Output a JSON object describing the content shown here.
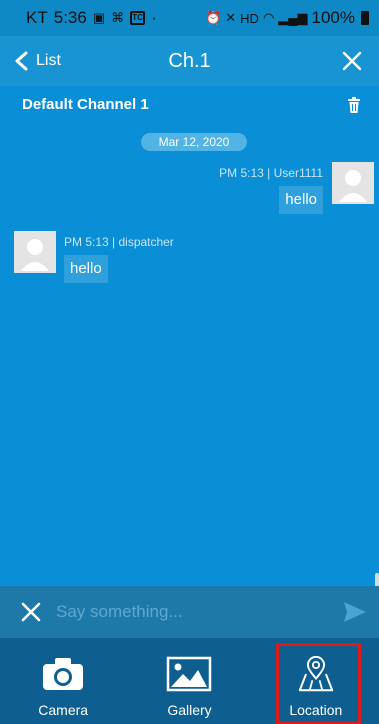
{
  "status_bar": {
    "carrier": "KT",
    "time": "5:36",
    "battery": "100%",
    "icons": [
      "image-icon",
      "lens-icon",
      "tc-app-icon",
      "alarm-icon",
      "mute-icon",
      "hd-icon",
      "wifi-icon",
      "signal-icon",
      "battery-icon"
    ],
    "tc_label": "TC",
    "hd_label": "HD",
    "dot": "·"
  },
  "header": {
    "back_label": "List",
    "title": "Ch.1"
  },
  "channel": {
    "name": "Default Channel 1"
  },
  "date_separator": "Mar 12, 2020",
  "messages": [
    {
      "meta": "PM 5:13 | User1111",
      "text": "hello",
      "side": "right"
    },
    {
      "meta": "PM 5:13 | dispatcher",
      "text": "hello",
      "side": "left"
    }
  ],
  "composer": {
    "placeholder": "Say something..."
  },
  "actions": [
    {
      "label": "Camera",
      "icon": "camera-icon"
    },
    {
      "label": "Gallery",
      "icon": "image-gallery-icon"
    },
    {
      "label": "Location",
      "icon": "map-pin-icon"
    }
  ],
  "colors": {
    "accent": "#1894d2",
    "chat_background": "#0a8ed6",
    "bottom_bar": "#0e5f8f",
    "highlight": "#e01a1a"
  }
}
